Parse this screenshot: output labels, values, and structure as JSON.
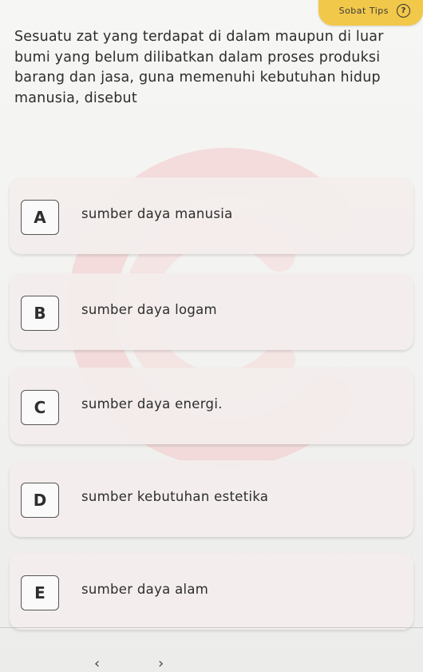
{
  "tips": {
    "label": "Sobat Tips",
    "icon": "question-mark-icon",
    "icon_glyph": "?",
    "background_color": "#f2c84b"
  },
  "question": {
    "text": "Sesuatu zat yang terdapat di dalam maupun di luar bumi yang belum dilibatkan dalam proses produksi barang dan jasa, guna memenuhi kebutuhan hidup manusia, disebut"
  },
  "options": [
    {
      "letter": "A",
      "text": "sumber daya manusia"
    },
    {
      "letter": "B",
      "text": "sumber daya logam"
    },
    {
      "letter": "C",
      "text": "sumber daya energi."
    },
    {
      "letter": "D",
      "text": "sumber kebutuhan estetika"
    },
    {
      "letter": "E",
      "text": "sumber daya alam"
    }
  ],
  "navigation": {
    "prev_glyph": "‹",
    "next_glyph": "›"
  }
}
